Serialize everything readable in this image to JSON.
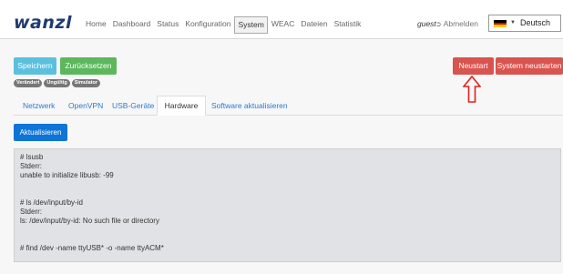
{
  "header": {
    "logo_text": "wanzl",
    "nav": [
      "Home",
      "Dashboard",
      "Status",
      "Konfiguration",
      "System",
      "WEAC",
      "Dateien",
      "Statistik"
    ],
    "active_nav": "System",
    "user": "guest",
    "logout_label": "Abmelden",
    "language": "Deutsch"
  },
  "actions": {
    "save_label": "Speichern",
    "reset_label": "Zurücksetzen",
    "restart_label": "Neustart",
    "system_restart_label": "System neustarten"
  },
  "badges": [
    "Verändert",
    "Ungültig",
    "Simulator"
  ],
  "tabs": {
    "items": [
      "Netzwerk",
      "OpenVPN",
      "USB-Geräte",
      "Hardware",
      "Software aktualisieren"
    ],
    "active": "Hardware"
  },
  "hardware": {
    "refresh_label": "Aktualisieren",
    "console_lines": [
      "# lsusb",
      "Stderr:",
      "unable to initialize libusb: -99",
      "",
      "",
      "# ls /dev/input/by-id",
      "Stderr:",
      "ls: /dev/input/by-id: No such file or directory",
      "",
      "",
      "# find /dev -name ttyUSB* -o -name ttyACM*"
    ]
  },
  "colors": {
    "brand": "#1f3b72",
    "save": "#5bc0de",
    "reset": "#5cb85c",
    "danger": "#d9534f",
    "primary": "#0d74d8",
    "annotation_arrow": "#e02020"
  },
  "icons": {
    "logout": "sign-out-icon",
    "language_flag": "german-flag-icon",
    "annotation": "arrow-up-icon"
  }
}
